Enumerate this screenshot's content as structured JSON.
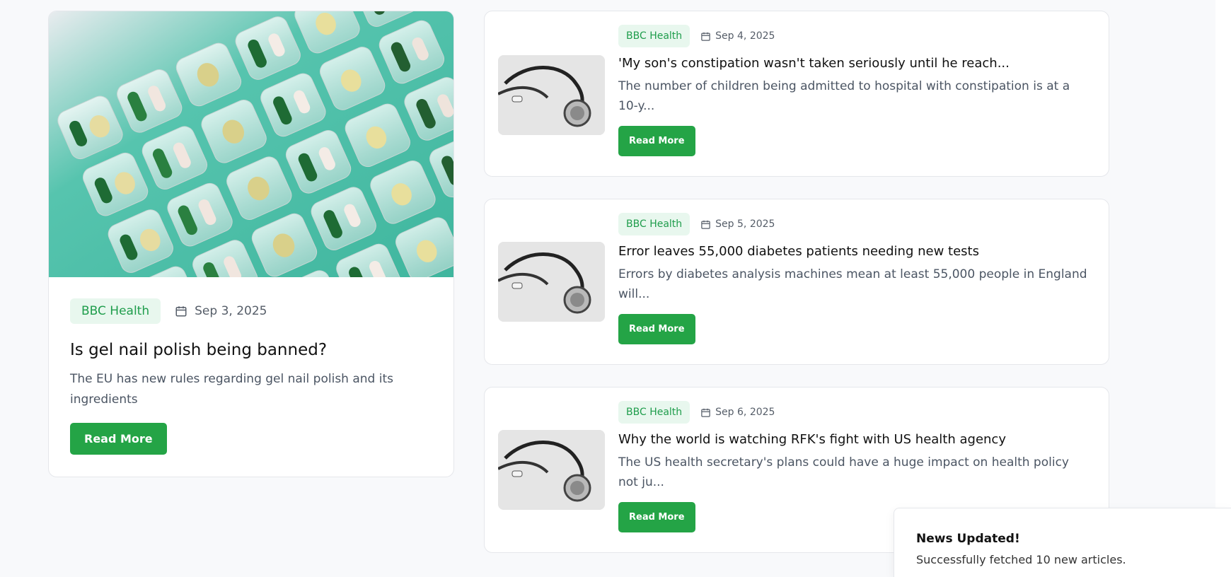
{
  "featured": {
    "source": "BBC Health",
    "date": "Sep 3, 2025",
    "title": "Is gel nail polish being banned?",
    "summary": "The EU has new rules regarding gel nail polish and its ingredients",
    "button": "Read More"
  },
  "articles": [
    {
      "source": "BBC Health",
      "date": "Sep 4, 2025",
      "title": "'My son's constipation wasn't taken seriously until he reach...",
      "summary": "The number of children being admitted to hospital with constipation is at a 10-y...",
      "button": "Read More"
    },
    {
      "source": "BBC Health",
      "date": "Sep 5, 2025",
      "title": "Error leaves 55,000 diabetes patients needing new tests",
      "summary": "Errors by diabetes analysis machines mean at least 55,000 people in England will...",
      "button": "Read More"
    },
    {
      "source": "BBC Health",
      "date": "Sep 6, 2025",
      "title": "Why the world is watching RFK's fight with US health agency",
      "summary": "The US health secretary's plans could have a huge impact on health policy not ju...",
      "button": "Read More"
    }
  ],
  "toast": {
    "title": "News Updated!",
    "message": "Successfully fetched 10 new articles."
  },
  "colors": {
    "accent": "#24a446",
    "tag_bg": "#e8f7ee",
    "tag_text": "#1f9d4c"
  },
  "icons": [
    "calendar-icon",
    "pills-image",
    "stethoscope-image"
  ]
}
